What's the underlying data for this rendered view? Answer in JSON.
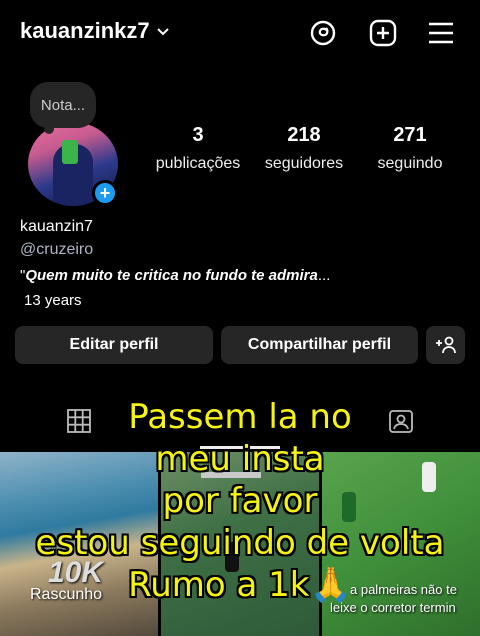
{
  "header": {
    "username": "kauanzinkz7"
  },
  "profile": {
    "note": "Nota...",
    "stats": [
      {
        "value": "3",
        "label": "publicações"
      },
      {
        "value": "218",
        "label": "seguidores"
      },
      {
        "value": "271",
        "label": "seguindo"
      }
    ],
    "display_name": "kauanzin7",
    "threads_handle": "@cruzeiro",
    "bio_quote": "\"",
    "bio_text": "Quem muito te critica no fundo te admira",
    "bio_more": "...",
    "age": "13 years"
  },
  "buttons": {
    "edit": "Editar perfil",
    "share": "Compartilhar perfil"
  },
  "grid": {
    "draft_label": "Rascunho",
    "tile1_text": "10K",
    "tile3_line1": "a palmeiras não te",
    "tile3_line2": "leixe o corretor termin"
  },
  "overlay": {
    "line1": "Passem la no",
    "line2": "meu insta",
    "line3": "por favor",
    "line4": "estou seguindo de volta",
    "line5": "Rumo a 1k",
    "emoji": "🙏"
  },
  "colors": {
    "accent_blue": "#1d9bf0",
    "overlay_yellow": "#f5f312",
    "button_bg": "#262626"
  }
}
